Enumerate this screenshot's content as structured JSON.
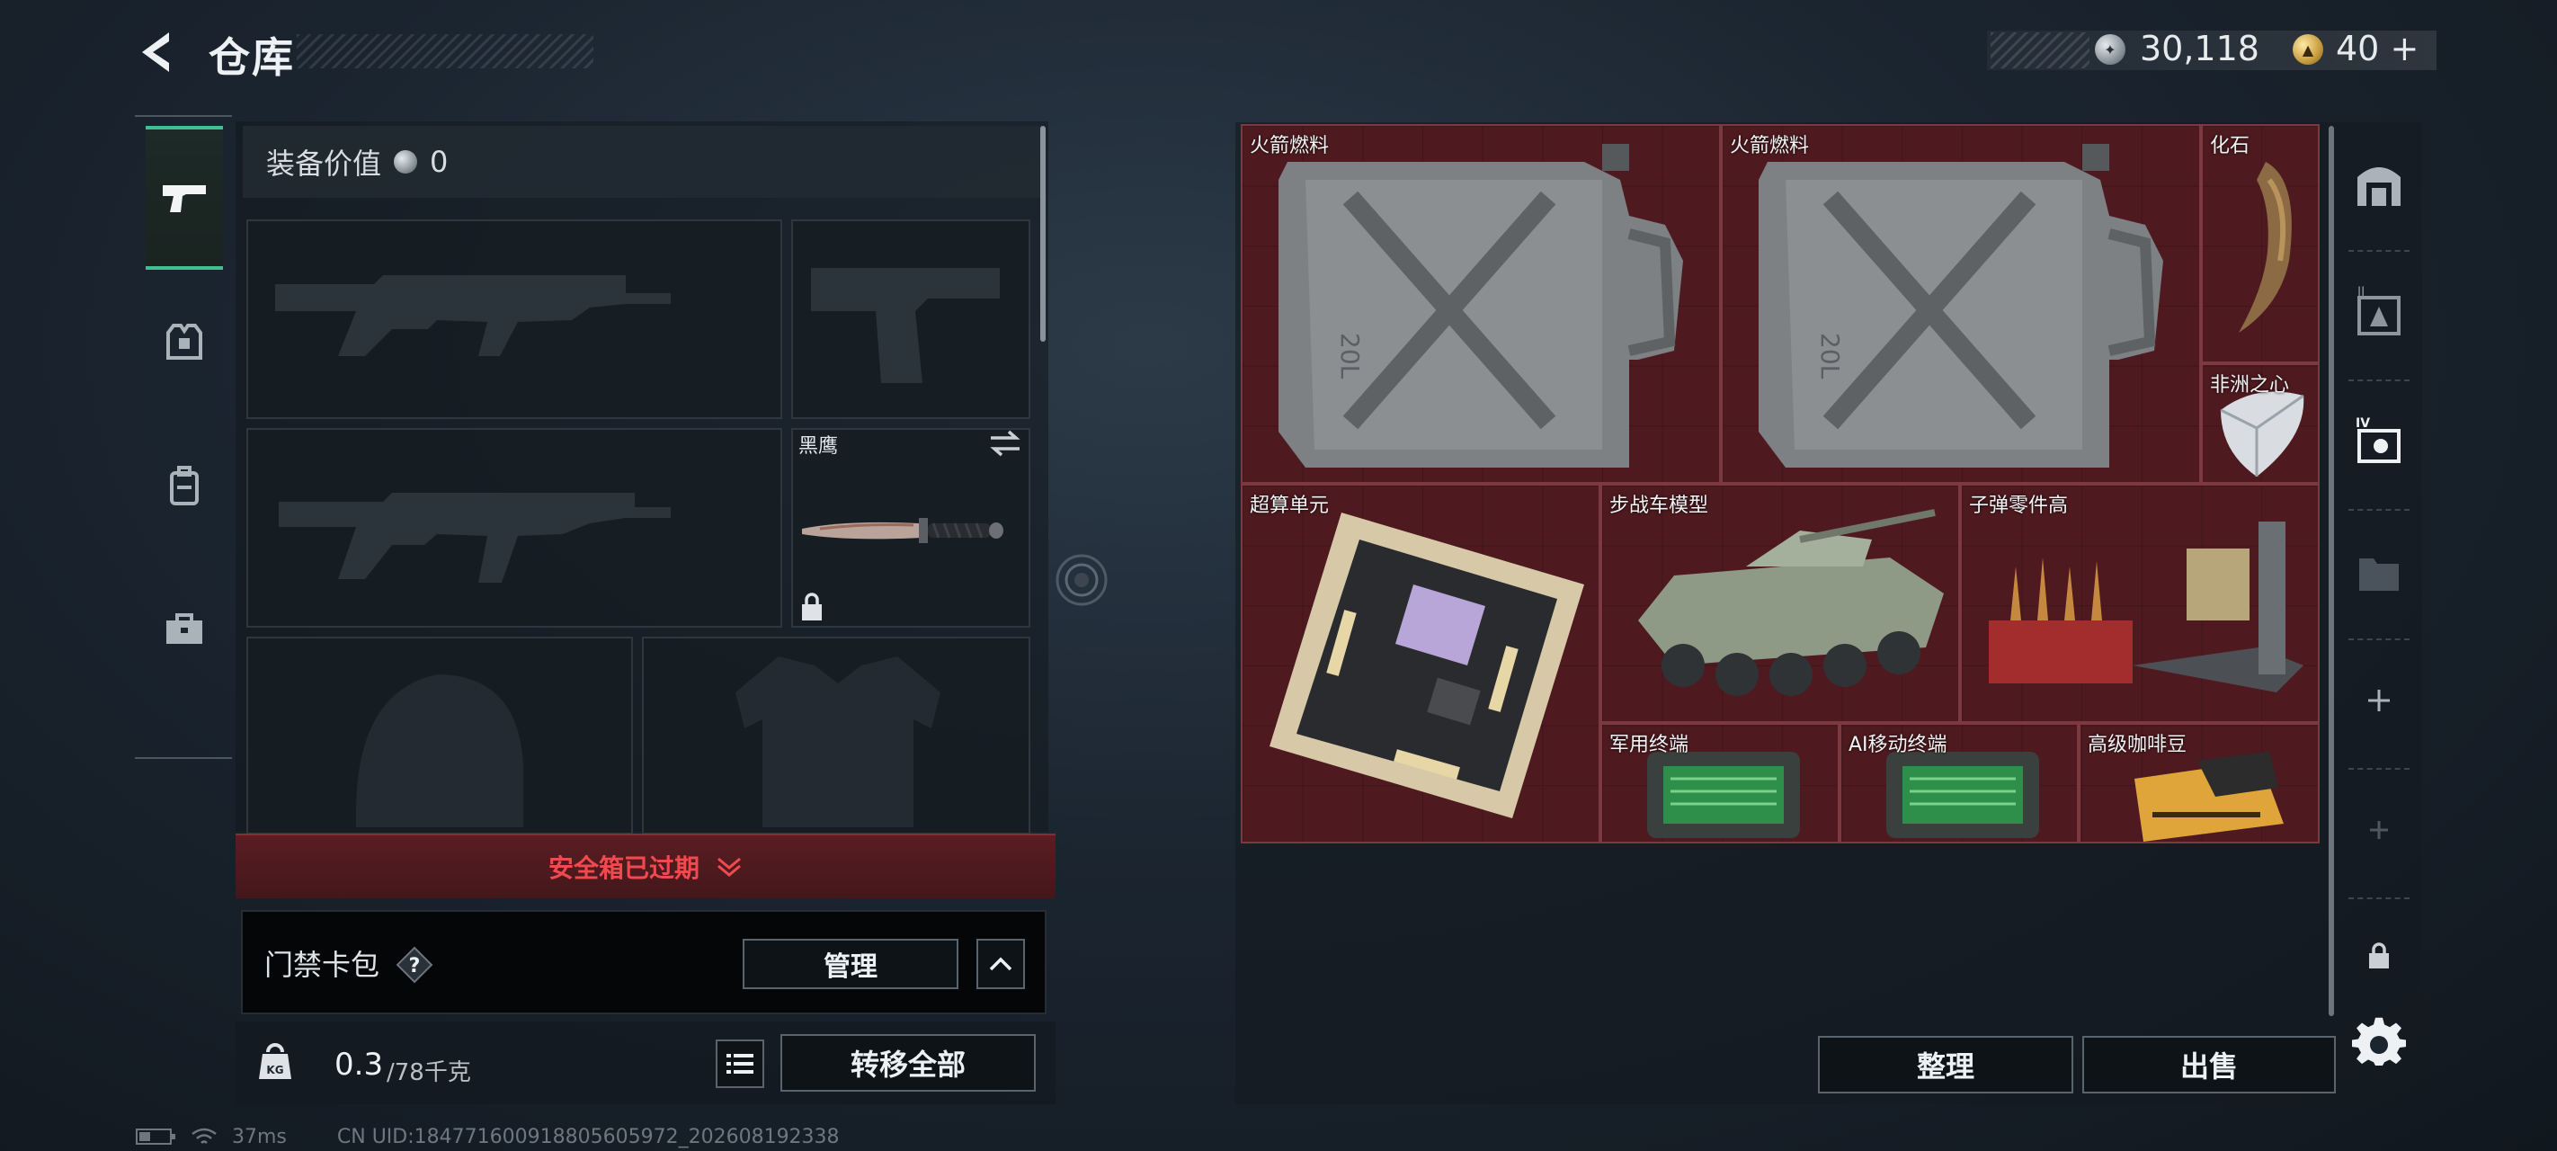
{
  "header": {
    "title": "仓库"
  },
  "currency": {
    "silver": "30,118",
    "gold": "40",
    "gold_plus": "+"
  },
  "equipment": {
    "value_label": "装备价值",
    "value": "0"
  },
  "knife_slot": {
    "name": "黑鹰"
  },
  "safe_box": {
    "label": "安全箱已过期"
  },
  "keycard": {
    "label": "门禁卡包",
    "help": "?",
    "manage": "管理"
  },
  "weight": {
    "current": "0.3",
    "max": "/78千克"
  },
  "buttons": {
    "transfer_all": "转移全部",
    "sort": "整理",
    "sell": "出售"
  },
  "stash_items": [
    {
      "label": "火箭燃料",
      "icon": "jerry-can"
    },
    {
      "label": "火箭燃料",
      "icon": "jerry-can"
    },
    {
      "label": "化石",
      "icon": "claw-fossil"
    },
    {
      "label": "非洲之心",
      "icon": "diamond"
    },
    {
      "label": "超算单元",
      "icon": "circuit-board"
    },
    {
      "label": "步战车模型",
      "icon": "armored-vehicle"
    },
    {
      "label": "子弹零件高",
      "icon": "ammo-parts"
    },
    {
      "label": "军用终端",
      "icon": "terminal"
    },
    {
      "label": "AI移动终端",
      "icon": "terminal"
    },
    {
      "label": "高级咖啡豆",
      "icon": "coffee-bag"
    }
  ],
  "status": {
    "ping": "37ms",
    "uid": "CN UID:184771600918805605972_202608192338"
  },
  "colors": {
    "accent_green": "#3fbf92",
    "stash_red": "#4d1b20",
    "warning_red": "#f04a4f"
  }
}
